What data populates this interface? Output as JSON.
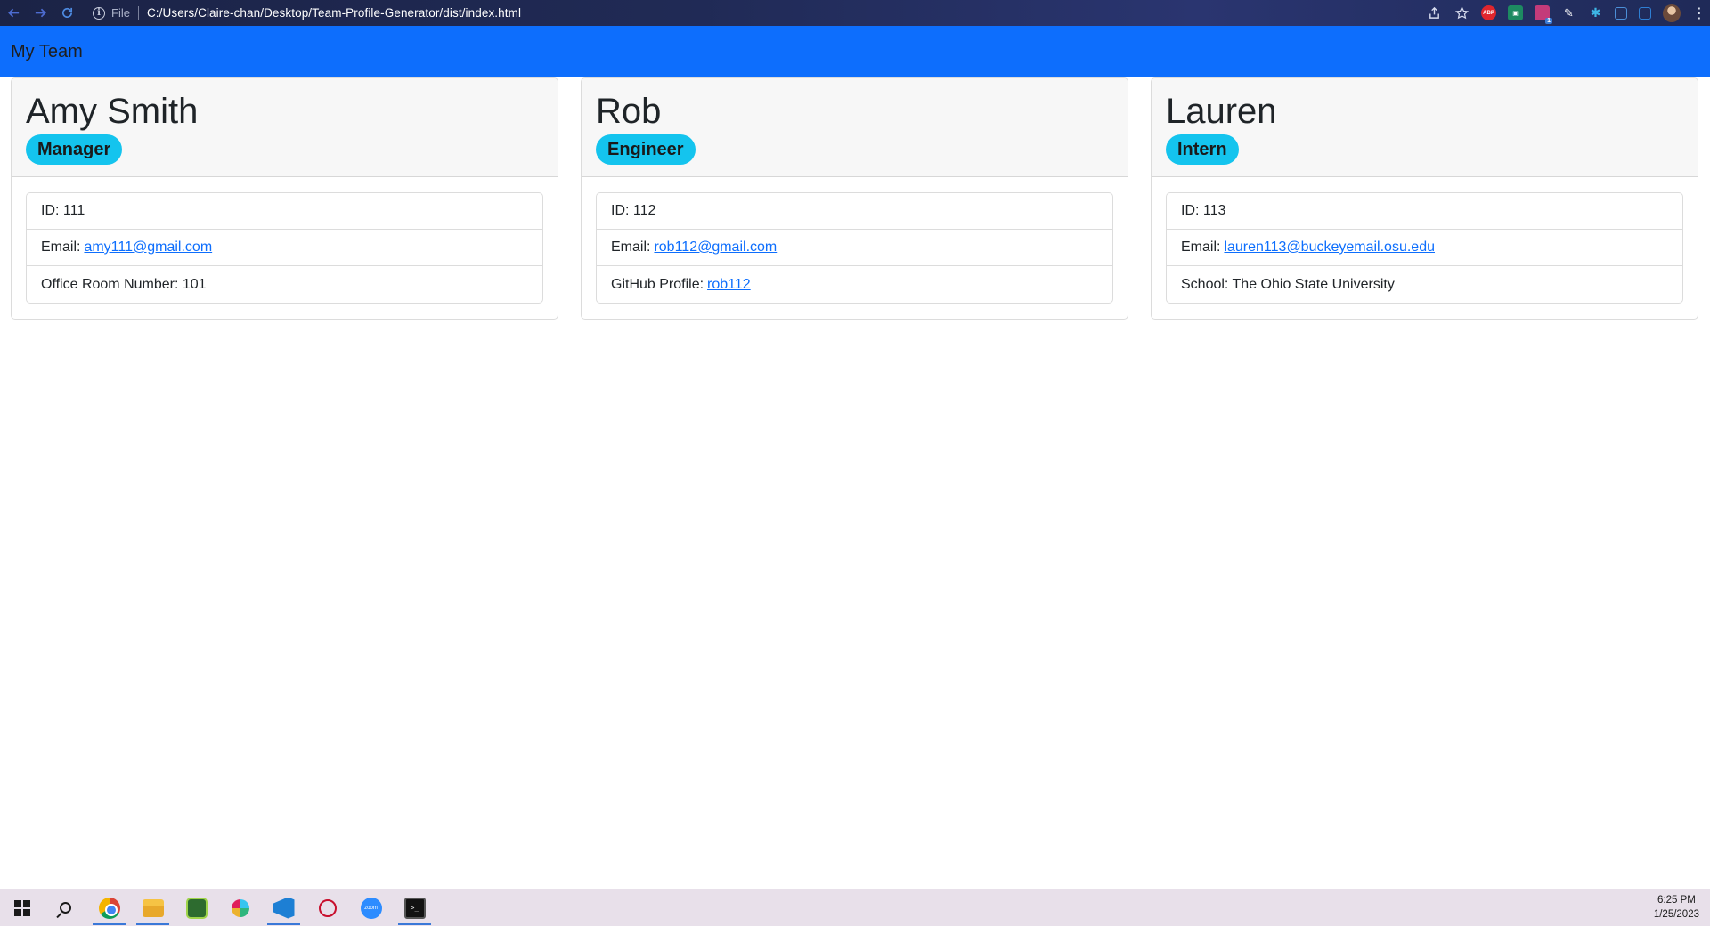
{
  "browser": {
    "file_label": "File",
    "url": "C:/Users/Claire-chan/Desktop/Team-Profile-Generator/dist/index.html",
    "extensions": {
      "abp": "ABP",
      "gift_badge": "1"
    }
  },
  "navbar": {
    "brand": "My Team"
  },
  "employees": [
    {
      "name": "Amy Smith",
      "role": "Manager",
      "id": "ID: 111",
      "email_label": "Email:",
      "email": "amy111@gmail.com",
      "extra": "Office Room Number: 101"
    },
    {
      "name": "Rob",
      "role": "Engineer",
      "id": "ID: 112",
      "email_label": "Email:",
      "email": "rob112@gmail.com",
      "extra_label": "GitHub Profile:",
      "extra_link": "rob112"
    },
    {
      "name": "Lauren",
      "role": "Intern",
      "id": "ID: 113",
      "email_label": "Email:",
      "email": "lauren113@buckeyemail.osu.edu",
      "extra": "School: The Ohio State University"
    }
  ],
  "taskbar": {
    "time": "6:25 PM",
    "date": "1/25/2023",
    "zoom_label": "zoom",
    "terminal_label": ">_"
  },
  "colors": {
    "navbar": "#0d6efd",
    "badge": "#14c4ee",
    "link": "#0d6efd"
  }
}
